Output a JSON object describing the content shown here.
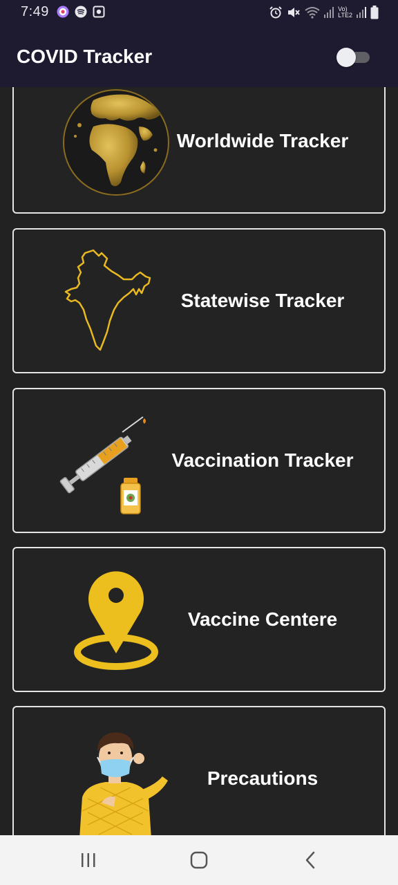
{
  "status_bar": {
    "time": "7:49",
    "network_label_top": "Vo)",
    "network_label_bottom": "LTE2",
    "icons": [
      "messenger-icon",
      "spotify-icon",
      "screen-record-icon",
      "alarm-icon",
      "mute-icon",
      "wifi-icon",
      "signal-icon",
      "battery-icon"
    ]
  },
  "app_bar": {
    "title": "COVID Tracker",
    "theme_toggle_on": false
  },
  "cards": [
    {
      "label": "Worldwide Tracker",
      "icon": "globe-icon"
    },
    {
      "label": "Statewise Tracker",
      "icon": "india-map-icon"
    },
    {
      "label": "Vaccination Tracker",
      "icon": "syringe-vial-icon"
    },
    {
      "label": "Vaccine Centere",
      "icon": "location-pin-icon"
    },
    {
      "label": "Precautions",
      "icon": "masked-person-icon"
    }
  ],
  "nav_bar": {
    "buttons": [
      "recent-apps-icon",
      "home-icon",
      "back-icon"
    ]
  },
  "colors": {
    "app_bar": "#1e1b30",
    "background": "#222222",
    "card_border": "#e6e6e6",
    "accent_gold": "#e8b921"
  }
}
